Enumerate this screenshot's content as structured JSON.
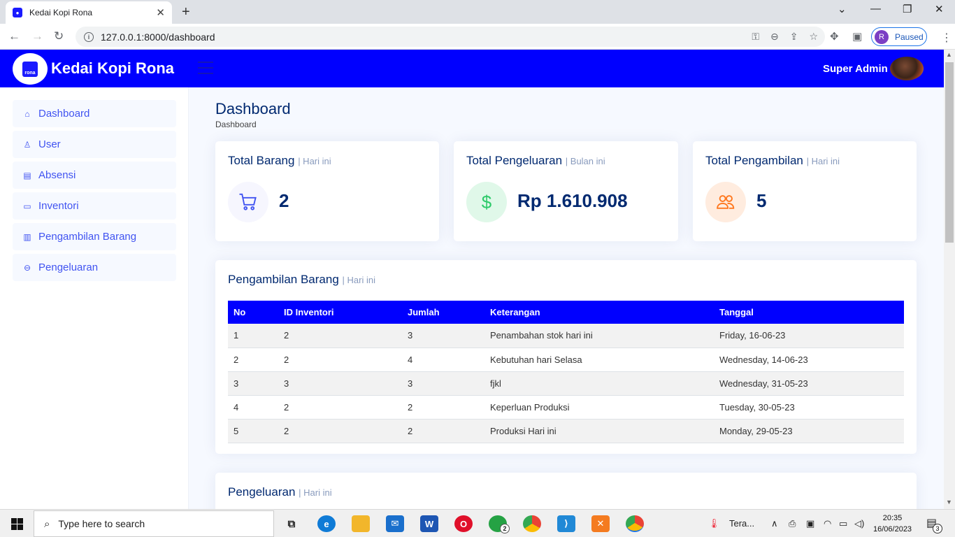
{
  "browser": {
    "tab_title": "Kedai Kopi Rona",
    "url": "127.0.0.1:8000/dashboard",
    "profile_initial": "R",
    "profile_status": "Paused"
  },
  "header": {
    "brand": "Kedai Kopi Rona",
    "logo_text": "rona",
    "user_name": "Super Admin"
  },
  "sidebar": {
    "items": [
      {
        "label": "Dashboard",
        "icon": "house-icon"
      },
      {
        "label": "User",
        "icon": "person-icon"
      },
      {
        "label": "Absensi",
        "icon": "clipboard-icon"
      },
      {
        "label": "Inventori",
        "icon": "archive-icon"
      },
      {
        "label": "Pengambilan Barang",
        "icon": "report-icon"
      },
      {
        "label": "Pengeluaran",
        "icon": "dash-circle-icon"
      }
    ]
  },
  "page": {
    "title": "Dashboard",
    "breadcrumb": "Dashboard"
  },
  "stats": [
    {
      "title": "Total Barang",
      "period": "| Hari ini",
      "value": "2",
      "icon": "cart-icon",
      "icon_color": "#4154f1",
      "icon_bg": "#f6f6fe"
    },
    {
      "title": "Total Pengeluaran",
      "period": "| Bulan ini",
      "value": "Rp 1.610.908",
      "icon": "dollar-icon",
      "icon_color": "#2eca6a",
      "icon_bg": "#e0f8e9"
    },
    {
      "title": "Total Pengambilan",
      "period": "| Hari ini",
      "value": "5",
      "icon": "people-icon",
      "icon_color": "#ff771d",
      "icon_bg": "#ffecdf"
    }
  ],
  "pengambilan": {
    "title": "Pengambilan Barang",
    "period": "| Hari ini",
    "columns": [
      "No",
      "ID Inventori",
      "Jumlah",
      "Keterangan",
      "Tanggal"
    ],
    "rows": [
      [
        "1",
        "2",
        "3",
        "Penambahan stok hari ini",
        "Friday, 16-06-23"
      ],
      [
        "2",
        "2",
        "4",
        "Kebutuhan hari Selasa",
        "Wednesday, 14-06-23"
      ],
      [
        "3",
        "3",
        "3",
        "fjkl",
        "Wednesday, 31-05-23"
      ],
      [
        "4",
        "2",
        "2",
        "Keperluan Produksi",
        "Tuesday, 30-05-23"
      ],
      [
        "5",
        "2",
        "2",
        "Produksi Hari ini",
        "Monday, 29-05-23"
      ]
    ]
  },
  "pengeluaran": {
    "title": "Pengeluaran",
    "period": "| Hari ini"
  },
  "taskbar": {
    "search_placeholder": "Type here to search",
    "weather": "Tera...",
    "time": "20:35",
    "date": "16/06/2023",
    "notifications": "3",
    "whatsapp_badge": "2"
  },
  "colors": {
    "primary": "#0000ff",
    "heading": "#012970",
    "accent": "#4154f1"
  }
}
